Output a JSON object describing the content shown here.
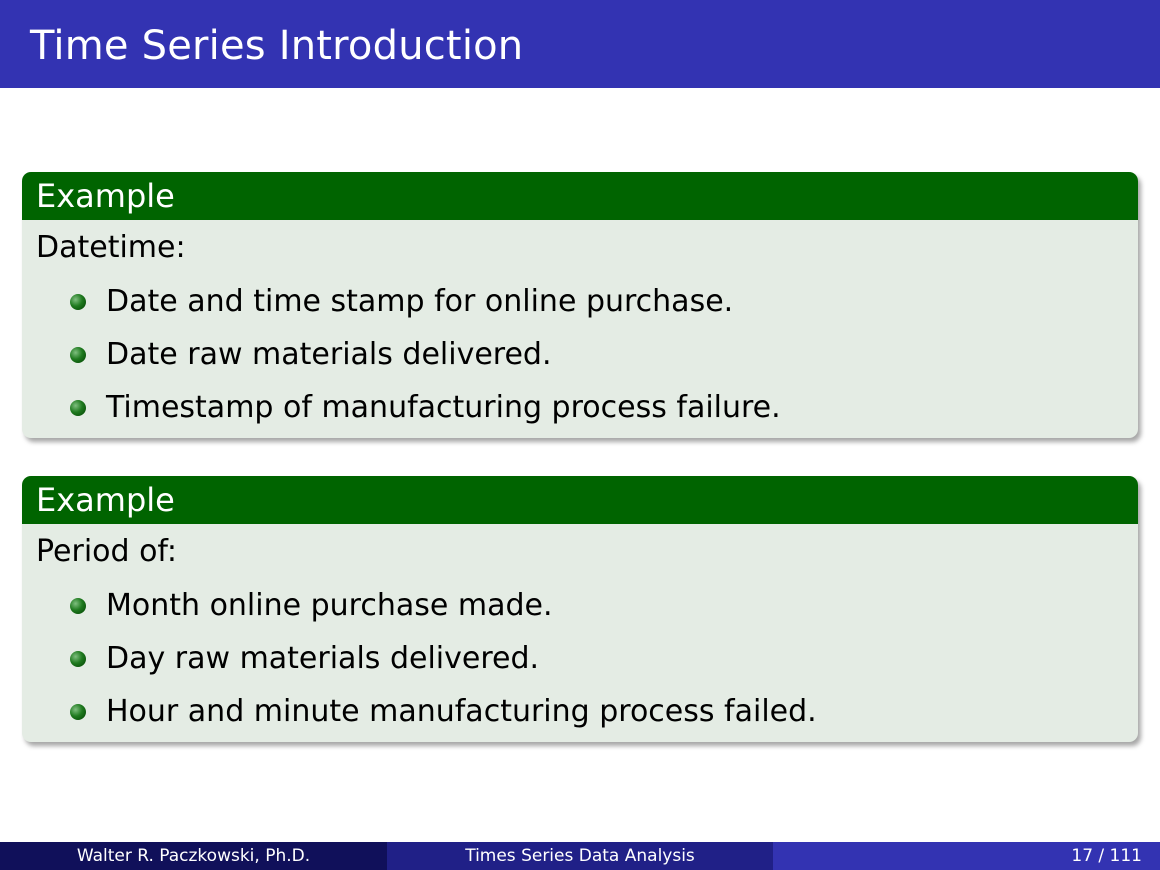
{
  "slide": {
    "title": "Time Series Introduction",
    "blocks": [
      {
        "header": "Example",
        "intro": "Datetime:",
        "items": [
          "Date and time stamp for online purchase.",
          "Date raw materials delivered.",
          "Timestamp of manufacturing process failure."
        ]
      },
      {
        "header": "Example",
        "intro": "Period of:",
        "items": [
          "Month online purchase made.",
          "Day raw materials delivered.",
          "Hour and minute manufacturing process failed."
        ]
      }
    ]
  },
  "footer": {
    "author": "Walter R. Paczkowski, Ph.D.",
    "title": "Times Series Data Analysis",
    "page": "17 / 111"
  },
  "colors": {
    "title_bar": "#3333b2",
    "block_header": "#006400",
    "block_body": "#e4ece4"
  }
}
